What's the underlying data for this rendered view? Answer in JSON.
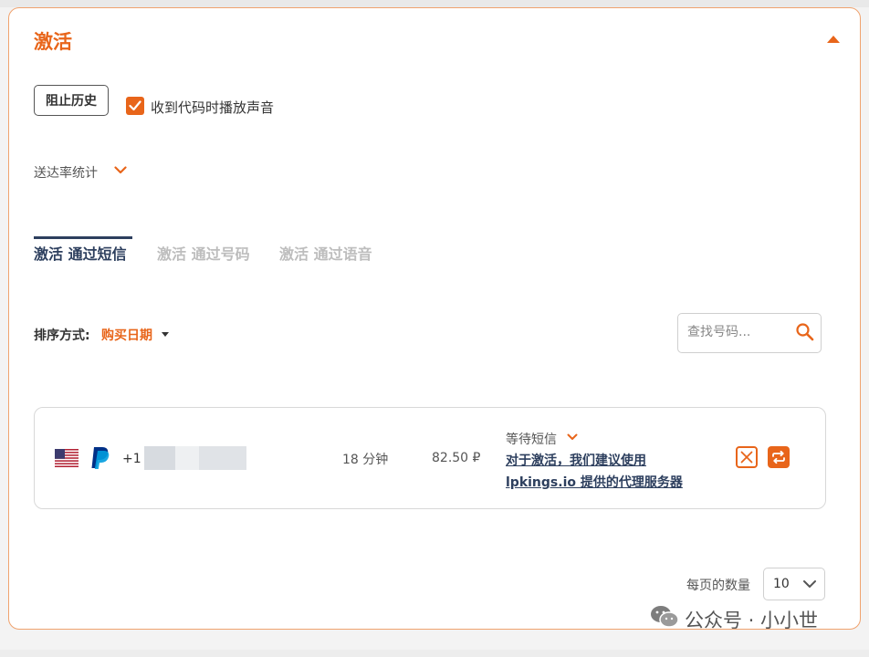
{
  "panel": {
    "title": "激活"
  },
  "controls": {
    "block_history_label": "阻止历史",
    "sound_checkbox_label": "收到代码时播放声音",
    "sound_checked": true,
    "delivery_stats_label": "送达率统计"
  },
  "tabs": [
    {
      "label": "激活 通过短信",
      "active": true
    },
    {
      "label": "激活 通过号码",
      "active": false
    },
    {
      "label": "激活 通过语音",
      "active": false
    }
  ],
  "sort": {
    "label": "排序方式:",
    "value": "购买日期"
  },
  "search": {
    "placeholder": "查找号码..."
  },
  "activations": [
    {
      "country_flag": "us-flag-icon",
      "service_icon": "paypal-icon",
      "phone_prefix": "+1 (",
      "duration": "18 分钟",
      "price": "82.50 ₽",
      "status": "等待短信",
      "proxy_notice": "对于激活，我们建议使用 lpkings.io 提供的代理服务器"
    }
  ],
  "pagination": {
    "per_page_label": "每页的数量",
    "per_page_value": "10"
  },
  "watermark": {
    "text": "公众号 · 小小世"
  },
  "colors": {
    "accent": "#e8651a",
    "tab_active": "#2d3f5e",
    "tab_inactive": "#bdbdbd",
    "card_border": "#f0a26e"
  }
}
